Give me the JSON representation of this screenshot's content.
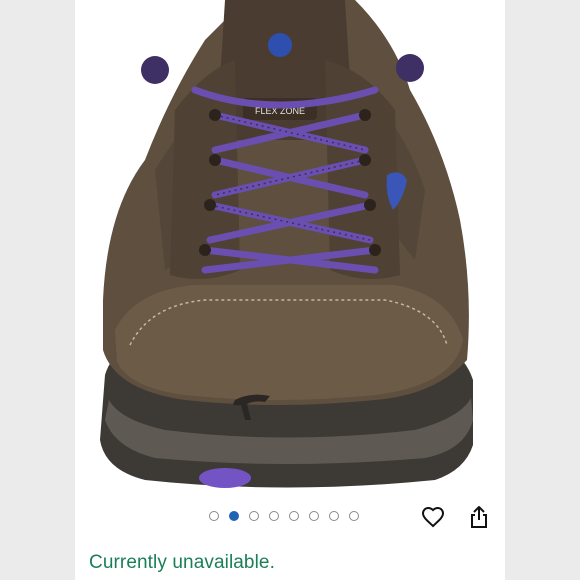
{
  "product": {
    "image_alt": "Brown hiking shoe with purple laces",
    "tongue_label": "FLEX ZONE"
  },
  "gallery": {
    "total_images": 8,
    "active_index": 1
  },
  "actions": {
    "favorite_icon": "heart-outline-icon",
    "share_icon": "share-icon"
  },
  "availability": {
    "status_text": "Currently unavailable."
  },
  "colors": {
    "status_green": "#1a7f57",
    "active_dot": "#1f63b5",
    "shoe_brown": "#5e4f3e",
    "lace_purple": "#6a4fb0"
  }
}
